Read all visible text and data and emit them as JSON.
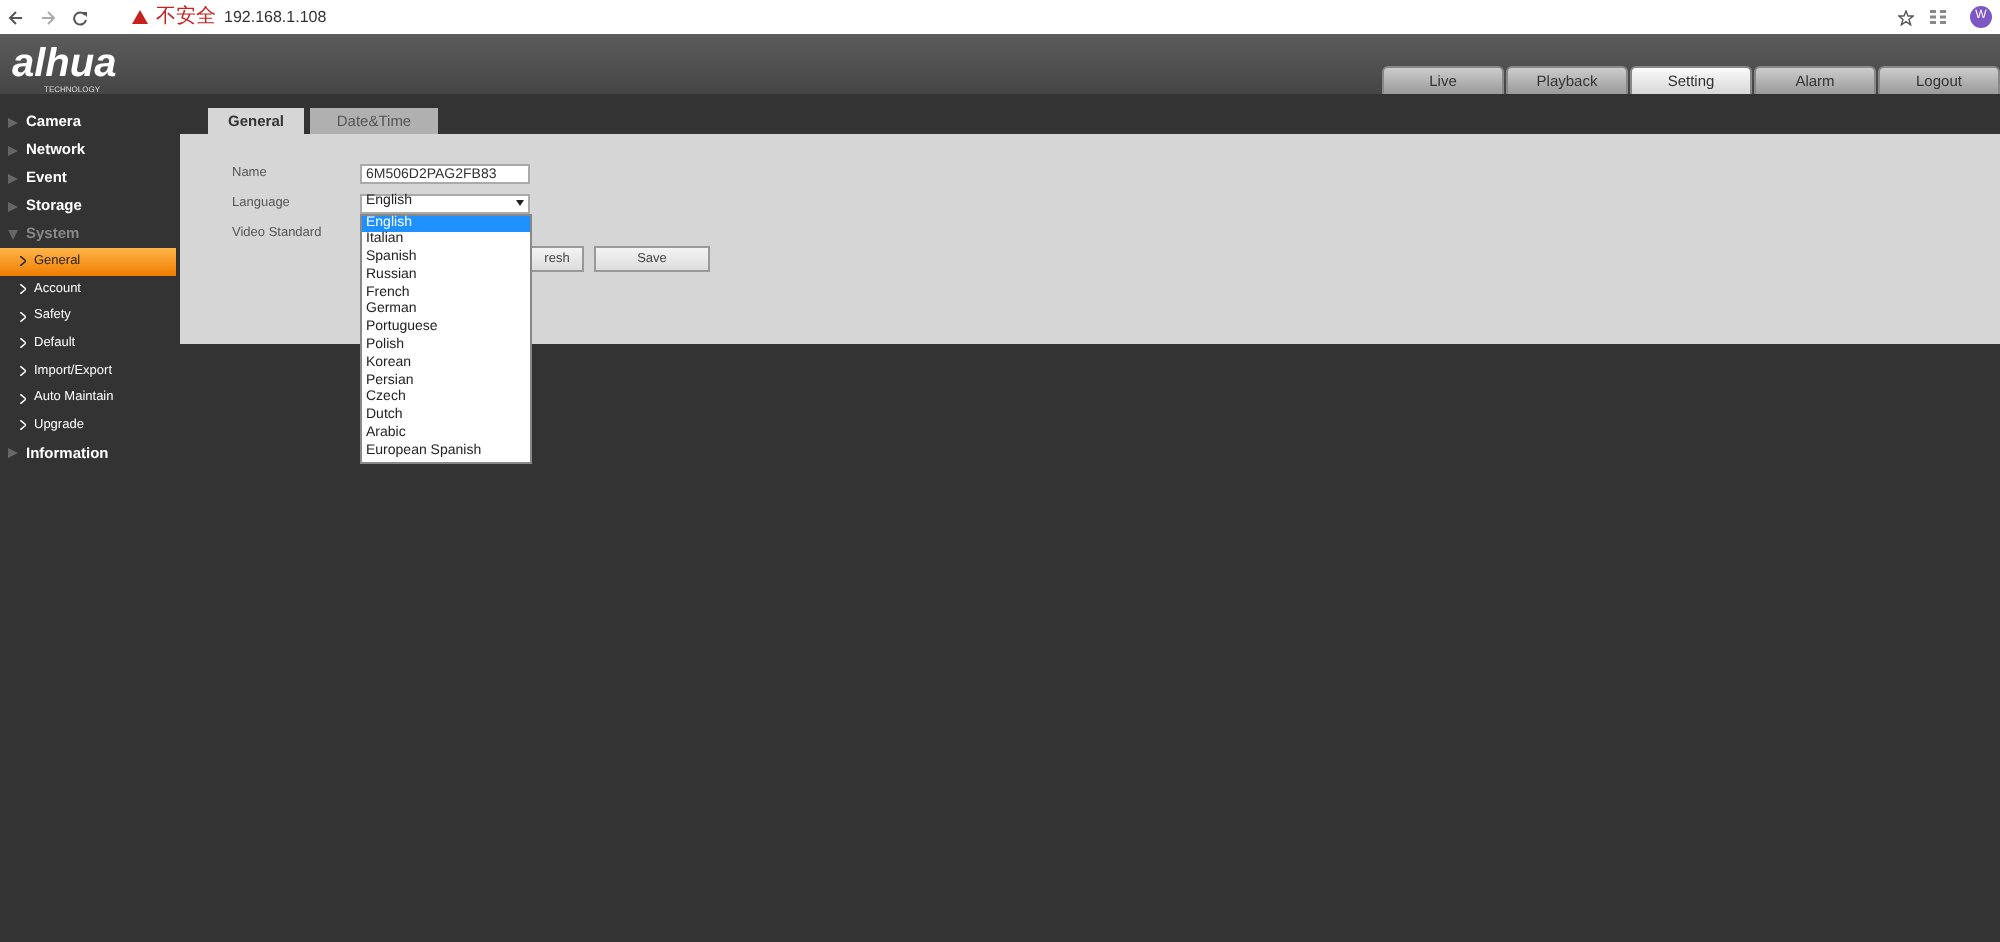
{
  "browser": {
    "security_label": "不安全",
    "url": "192.168.1.108",
    "profile_initial": "W"
  },
  "header": {
    "logo": "alhua",
    "logo_sub": "TECHNOLOGY",
    "nav": [
      {
        "label": "Live",
        "selected": false
      },
      {
        "label": "Playback",
        "selected": false
      },
      {
        "label": "Setting",
        "selected": true
      },
      {
        "label": "Alarm",
        "selected": false
      },
      {
        "label": "Logout",
        "selected": false
      }
    ]
  },
  "sidebar": {
    "items": [
      {
        "label": "Camera",
        "expanded": false
      },
      {
        "label": "Network",
        "expanded": false
      },
      {
        "label": "Event",
        "expanded": false
      },
      {
        "label": "Storage",
        "expanded": false
      },
      {
        "label": "System",
        "expanded": true,
        "children": [
          {
            "label": "General",
            "selected": true
          },
          {
            "label": "Account",
            "selected": false
          },
          {
            "label": "Safety",
            "selected": false
          },
          {
            "label": "Default",
            "selected": false
          },
          {
            "label": "Import/Export",
            "selected": false
          },
          {
            "label": "Auto Maintain",
            "selected": false
          },
          {
            "label": "Upgrade",
            "selected": false
          }
        ]
      },
      {
        "label": "Information",
        "expanded": false
      }
    ]
  },
  "tabs": [
    {
      "label": "General",
      "selected": true
    },
    {
      "label": "Date&Time",
      "selected": false
    }
  ],
  "form": {
    "fields": [
      {
        "kind": "text",
        "label": "Name",
        "value": "6M506D2PAG2FB83"
      },
      {
        "kind": "select",
        "label": "Language",
        "value": "English"
      },
      {
        "kind": "hidden",
        "label": "Video Standard"
      }
    ]
  },
  "dropdown": {
    "options": [
      {
        "label": "English",
        "selected": true
      },
      {
        "label": "Italian",
        "selected": false
      },
      {
        "label": "Spanish",
        "selected": false
      },
      {
        "label": "Russian",
        "selected": false
      },
      {
        "label": "French",
        "selected": false
      },
      {
        "label": "German",
        "selected": false
      },
      {
        "label": "Portuguese",
        "selected": false
      },
      {
        "label": "Polish",
        "selected": false
      },
      {
        "label": "Korean",
        "selected": false
      },
      {
        "label": "Persian",
        "selected": false
      },
      {
        "label": "Czech",
        "selected": false
      },
      {
        "label": "Dutch",
        "selected": false
      },
      {
        "label": "Arabic",
        "selected": false
      },
      {
        "label": "European Spanish",
        "selected": false
      }
    ]
  },
  "buttons": [
    "resh",
    "Save"
  ]
}
